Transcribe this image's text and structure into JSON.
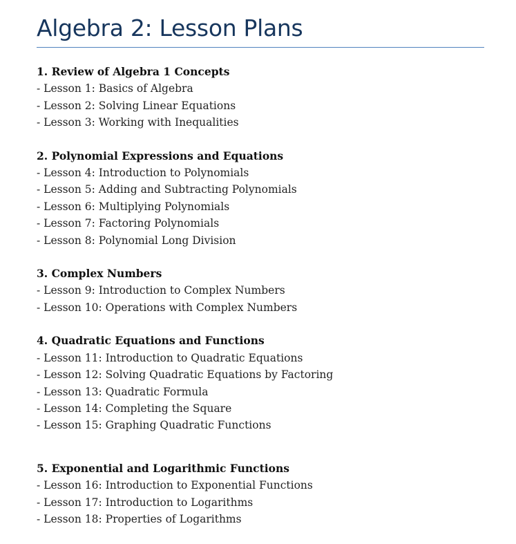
{
  "document": {
    "title": "Algebra 2: Lesson Plans",
    "sections": [
      {
        "heading": "1. Review of Algebra 1 Concepts",
        "lessons": [
          "- Lesson 1: Basics of Algebra",
          "- Lesson 2: Solving Linear Equations",
          "- Lesson 3: Working with Inequalities"
        ]
      },
      {
        "heading": "2. Polynomial Expressions and Equations",
        "lessons": [
          "- Lesson 4: Introduction to Polynomials",
          "- Lesson 5: Adding and Subtracting Polynomials",
          "- Lesson 6: Multiplying Polynomials",
          "- Lesson 7: Factoring Polynomials",
          "- Lesson 8: Polynomial Long Division"
        ]
      },
      {
        "heading": "3. Complex Numbers",
        "lessons": [
          "- Lesson 9: Introduction to Complex Numbers",
          "- Lesson 10: Operations with Complex Numbers"
        ]
      },
      {
        "heading": "4. Quadratic Equations and Functions",
        "lessons": [
          "- Lesson 11: Introduction to Quadratic Equations",
          "- Lesson 12: Solving Quadratic Equations by Factoring",
          "- Lesson 13: Quadratic Formula",
          "- Lesson 14: Completing the Square",
          "- Lesson 15: Graphing Quadratic Functions"
        ]
      },
      {
        "heading": "5. Exponential and Logarithmic Functions",
        "lessons": [
          "- Lesson 16: Introduction to Exponential Functions",
          "- Lesson 17: Introduction to Logarithms",
          "- Lesson 18: Properties of Logarithms"
        ]
      }
    ]
  }
}
